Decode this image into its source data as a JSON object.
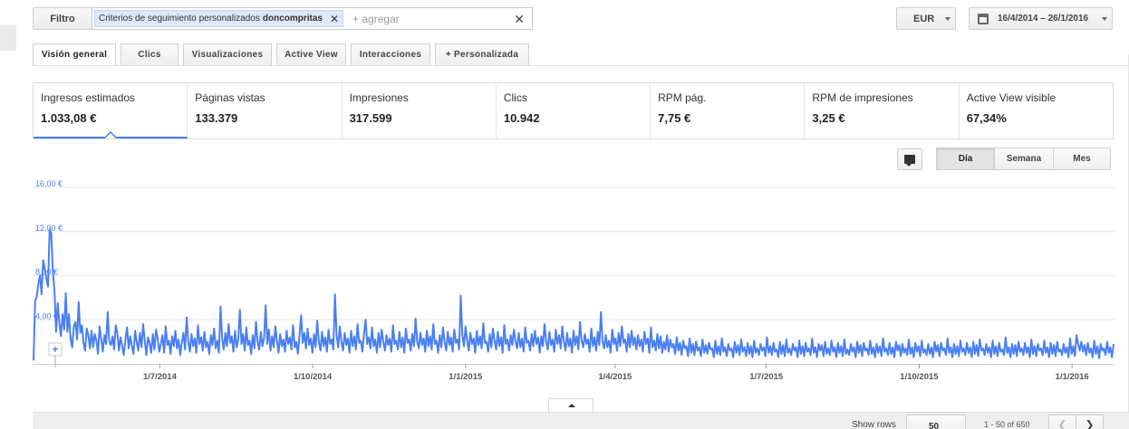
{
  "filter": {
    "button_label": "Filtro",
    "chip_prefix": "Criterios de seguimiento personalizados",
    "chip_value": "doncompritas",
    "add_placeholder": "+ agregar"
  },
  "currency": {
    "selected": "EUR"
  },
  "date_range": {
    "label": "16/4/2014 – 26/1/2016"
  },
  "tabs": [
    {
      "label": "Visión general",
      "active": true
    },
    {
      "label": "Clics",
      "active": false
    },
    {
      "label": "Visualizaciones",
      "active": false
    },
    {
      "label": "Active View",
      "active": false
    },
    {
      "label": "Interacciones",
      "active": false
    },
    {
      "label": "+ Personalizada",
      "active": false
    }
  ],
  "metrics": [
    {
      "label": "Ingresos estimados",
      "value": "1.033,08 €",
      "active": true
    },
    {
      "label": "Páginas vistas",
      "value": "133.379",
      "active": false
    },
    {
      "label": "Impresiones",
      "value": "317.599",
      "active": false
    },
    {
      "label": "Clics",
      "value": "10.942",
      "active": false
    },
    {
      "label": "RPM pág.",
      "value": "7,75 €",
      "active": false
    },
    {
      "label": "RPM de impresiones",
      "value": "3,25 €",
      "active": false
    },
    {
      "label": "Active View visible",
      "value": "67,34%",
      "active": false
    }
  ],
  "period_buttons": [
    {
      "label": "Día",
      "active": true
    },
    {
      "label": "Semana",
      "active": false
    },
    {
      "label": "Mes",
      "active": false
    }
  ],
  "pagination": {
    "show_rows_label": "Show rows",
    "rows_value": "50",
    "range_text": "1 - 50 of 650",
    "prev": "❮",
    "next": "❯"
  },
  "colors": {
    "series": "#4a7ff2",
    "accent": "#4a7ff2"
  },
  "icons": [
    "close-icon",
    "calendar-icon",
    "comment-icon",
    "chevron-left-icon",
    "chevron-right-icon",
    "add-annotation-icon",
    "collapse-arrow-icon"
  ],
  "chart_data": {
    "type": "line",
    "title": "",
    "xlabel": "",
    "ylabel": "",
    "ylim": [
      0,
      16
    ],
    "y_ticks": [
      "16,00 €",
      "12,00 €",
      "8,00 €",
      "4,00 €"
    ],
    "y_tick_values": [
      16,
      12,
      8,
      4
    ],
    "x_tick_labels": [
      "1/7/2014",
      "1/10/2014",
      "1/1/2015",
      "1/4/2015",
      "1/7/2015",
      "1/10/2015",
      "1/1/2016"
    ],
    "x_tick_dates": [
      "2014-07-01",
      "2014-10-01",
      "2015-01-01",
      "2015-04-01",
      "2015-07-01",
      "2015-10-01",
      "2016-01-01"
    ],
    "x_range": [
      "2014-04-16",
      "2016-01-26"
    ],
    "grid": true,
    "legend": "none",
    "series": [
      {
        "values": [
          0.3,
          5.7,
          6.1,
          7.3,
          8.0,
          6.3,
          9.4,
          8.6,
          7.7,
          7.0,
          12.2,
          11.8,
          8.4,
          6.6,
          2.9,
          5.5,
          3.7,
          2.5,
          4.5,
          3.1,
          6.4,
          2.9,
          4.5,
          2.2,
          1.5,
          3.4,
          3.8,
          2.2,
          5.6,
          2.8,
          3.5,
          1.9,
          1.2,
          3.2,
          2.6,
          1.4,
          3.0,
          1.5,
          2.7,
          2.1,
          0.9,
          3.4,
          2.2,
          1.1,
          2.6,
          1.8,
          4.7,
          2.0,
          1.7,
          2.5,
          1.3,
          3.5,
          2.8,
          1.2,
          2.4,
          1.6,
          0.8,
          2.2,
          3.3,
          1.4,
          2.5,
          1.6,
          0.9,
          3.0,
          2.0,
          1.2,
          2.8,
          1.5,
          3.6,
          2.1,
          0.8,
          2.4,
          1.9,
          1.0,
          2.7,
          1.3,
          3.1,
          2.3,
          1.1,
          1.8,
          2.6,
          1.0,
          3.4,
          1.7,
          2.1,
          0.9,
          2.5,
          1.6,
          3.0,
          1.4,
          2.2,
          0.8,
          1.9,
          2.8,
          1.3,
          4.2,
          2.0,
          1.1,
          2.7,
          1.6,
          2.3,
          1.0,
          3.5,
          1.8,
          2.4,
          1.2,
          2.9,
          1.5,
          2.0,
          0.9,
          2.6,
          1.7,
          3.2,
          1.4,
          2.1,
          1.0,
          5.2,
          2.3,
          1.3,
          2.8,
          1.6,
          3.6,
          1.9,
          2.5,
          1.1,
          3.0,
          1.5,
          2.2,
          4.9,
          1.8,
          2.7,
          1.2,
          3.3,
          1.7,
          2.1,
          0.9,
          2.6,
          1.4,
          3.8,
          2.0,
          1.3,
          2.9,
          1.6,
          2.3,
          5.3,
          1.8,
          3.1,
          1.2,
          2.5,
          1.5,
          3.4,
          2.1,
          1.0,
          2.7,
          1.6,
          2.2,
          1.1,
          3.0,
          1.8,
          2.4,
          1.3,
          3.5,
          1.5,
          2.0,
          0.9,
          2.6,
          4.4,
          1.9,
          2.8,
          1.4,
          3.2,
          1.7,
          2.3,
          1.0,
          2.7,
          1.5,
          3.9,
          2.0,
          1.2,
          2.9,
          1.6,
          2.4,
          1.1,
          3.1,
          1.8,
          2.2,
          1.3,
          6.3,
          2.6,
          1.5,
          3.4,
          2.0,
          1.2,
          2.8,
          1.7,
          2.3,
          1.0,
          3.0,
          1.6,
          2.5,
          1.3,
          3.6,
          1.9,
          2.1,
          1.1,
          2.7,
          4.0,
          1.8,
          2.4,
          1.4,
          3.3,
          1.6,
          2.2,
          1.0,
          2.8,
          1.5,
          3.1,
          2.0,
          1.2,
          2.6,
          1.7,
          2.3,
          1.1,
          3.5,
          1.8,
          2.1,
          1.3,
          2.9,
          1.5,
          2.4,
          1.0,
          3.2,
          1.9,
          2.2,
          1.2,
          2.7,
          1.6,
          4.1,
          2.0,
          1.4,
          2.8,
          1.7,
          2.3,
          1.1,
          3.0,
          1.6,
          2.5,
          1.3,
          3.6,
          1.8,
          2.1,
          1.0,
          2.6,
          1.5,
          3.3,
          2.0,
          1.2,
          2.9,
          1.7,
          2.4,
          1.1,
          3.1,
          1.9,
          2.2,
          1.3,
          6.2,
          2.6,
          1.6,
          3.4,
          2.1,
          1.2,
          2.8,
          1.8,
          2.3,
          1.0,
          3.0,
          1.7,
          2.5,
          1.4,
          3.7,
          1.9,
          2.0,
          1.1,
          2.7,
          1.5,
          3.2,
          2.1,
          1.3,
          2.9,
          1.6,
          2.4,
          1.0,
          3.5,
          1.8,
          2.2,
          1.2,
          2.6,
          1.7,
          3.1,
          2.0,
          1.4,
          2.8,
          1.5,
          2.3,
          1.1,
          3.3,
          1.9,
          2.1,
          1.2,
          2.7,
          1.6,
          3.0,
          1.8,
          2.4,
          1.0,
          2.5,
          1.6,
          3.6,
          2.0,
          1.3,
          2.9,
          1.7,
          2.2,
          1.1,
          3.1,
          1.8,
          2.6,
          1.4,
          3.4,
          2.0,
          1.2,
          2.8,
          1.6,
          2.3,
          1.0,
          3.0,
          1.7,
          2.5,
          1.3,
          3.8,
          2.1,
          1.5,
          2.7,
          1.8,
          2.2,
          1.1,
          3.2,
          1.6,
          2.4,
          1.2,
          2.9,
          1.7,
          4.7,
          2.0,
          1.4,
          2.6,
          1.5,
          2.1,
          1.0,
          3.1,
          1.8,
          2.3,
          1.2,
          2.8,
          1.6,
          3.4,
          1.9,
          2.2,
          1.1,
          2.7,
          1.5,
          3.0,
          1.7,
          2.4,
          1.3,
          2.6,
          1.6,
          2.2,
          1.1,
          2.9,
          1.8,
          2.3,
          1.0,
          3.3,
          1.5,
          2.1,
          1.2,
          2.7,
          1.4,
          2.5,
          1.0,
          2.0,
          1.3,
          2.6,
          1.1,
          2.2,
          1.5,
          1.8,
          0.9,
          2.4,
          1.2,
          1.9,
          0.8,
          2.1,
          1.4,
          1.6,
          0.7,
          2.3,
          1.0,
          1.8,
          0.8,
          2.0,
          1.2,
          1.5,
          0.7,
          2.2,
          1.0,
          1.7,
          0.9,
          1.9,
          1.3,
          1.4,
          0.6,
          2.1,
          0.9,
          1.6,
          0.8,
          2.3,
          1.1,
          1.5,
          0.7,
          1.8,
          1.2,
          1.4,
          0.6,
          2.0,
          1.0,
          1.7,
          0.8,
          2.2,
          1.1,
          1.5,
          0.7,
          1.9,
          0.9,
          1.6,
          0.6,
          2.1,
          1.0,
          1.4,
          0.8,
          1.8,
          1.2,
          1.5,
          0.7,
          2.4,
          1.0,
          1.6,
          0.8,
          1.9,
          1.1,
          1.3,
          0.6,
          2.0,
          0.9,
          1.7,
          0.7,
          2.2,
          1.0,
          1.4,
          0.8,
          1.8,
          1.2,
          1.5,
          0.6,
          2.1,
          0.9,
          1.6,
          0.7,
          1.9,
          1.1,
          1.4,
          0.8,
          2.3,
          1.0,
          1.5,
          0.6,
          1.8,
          1.2,
          1.7,
          0.7,
          2.0,
          0.9,
          1.4,
          0.8,
          2.1,
          1.1,
          1.5,
          0.6,
          1.9,
          1.0,
          1.6,
          0.7,
          2.2,
          0.9,
          1.3,
          0.8,
          1.8,
          1.1,
          1.5,
          0.6,
          2.0,
          1.0,
          1.7,
          0.7,
          1.9,
          1.2,
          1.4,
          0.8,
          2.1,
          0.9,
          1.5,
          0.6,
          1.8,
          1.0,
          1.6,
          0.7,
          2.3,
          1.1,
          1.4,
          0.8,
          1.9,
          0.9,
          1.5,
          0.6,
          2.0,
          1.2,
          1.7,
          0.7,
          1.8,
          1.0,
          1.4,
          0.8,
          2.2,
          0.9,
          1.5,
          0.6,
          1.9,
          1.1,
          1.6,
          0.7,
          2.1,
          1.0,
          1.3,
          0.8,
          1.8,
          0.9,
          1.5,
          0.6,
          2.0,
          1.1,
          1.7,
          0.7,
          1.9,
          1.2,
          1.4,
          0.8,
          2.3,
          1.0,
          1.5,
          0.6,
          1.8,
          0.9,
          1.6,
          0.7,
          2.1,
          1.1,
          1.4,
          0.8,
          1.9,
          1.0,
          1.5,
          0.6,
          2.0,
          0.9,
          1.7,
          0.7,
          2.2,
          1.2,
          1.4,
          0.8,
          1.8,
          1.0,
          1.5,
          0.6,
          2.1,
          0.9,
          1.6,
          0.7,
          1.9,
          1.1,
          1.3,
          0.8,
          2.4,
          1.0,
          1.5,
          0.6,
          1.8,
          0.9,
          1.7,
          0.7,
          2.0,
          1.1,
          1.4,
          0.8,
          1.9,
          1.0,
          1.5,
          0.6,
          2.2,
          0.9,
          1.6,
          0.7,
          1.8,
          1.2,
          1.4,
          0.8,
          2.1,
          1.0,
          1.5,
          0.6,
          1.9,
          0.9,
          1.7,
          0.7,
          2.0,
          1.1,
          1.3,
          0.8,
          1.8,
          1.0,
          1.5,
          0.6,
          2.3,
          0.9,
          1.6,
          0.7,
          2.6,
          1.8,
          1.2,
          2.0,
          1.1,
          1.7,
          0.8,
          1.9,
          1.0,
          1.4,
          0.6,
          2.1,
          0.9,
          1.6,
          0.5,
          1.8,
          1.2,
          1.4,
          0.8,
          2.0,
          1.0,
          1.5,
          0.6,
          1.8
        ]
      }
    ]
  }
}
